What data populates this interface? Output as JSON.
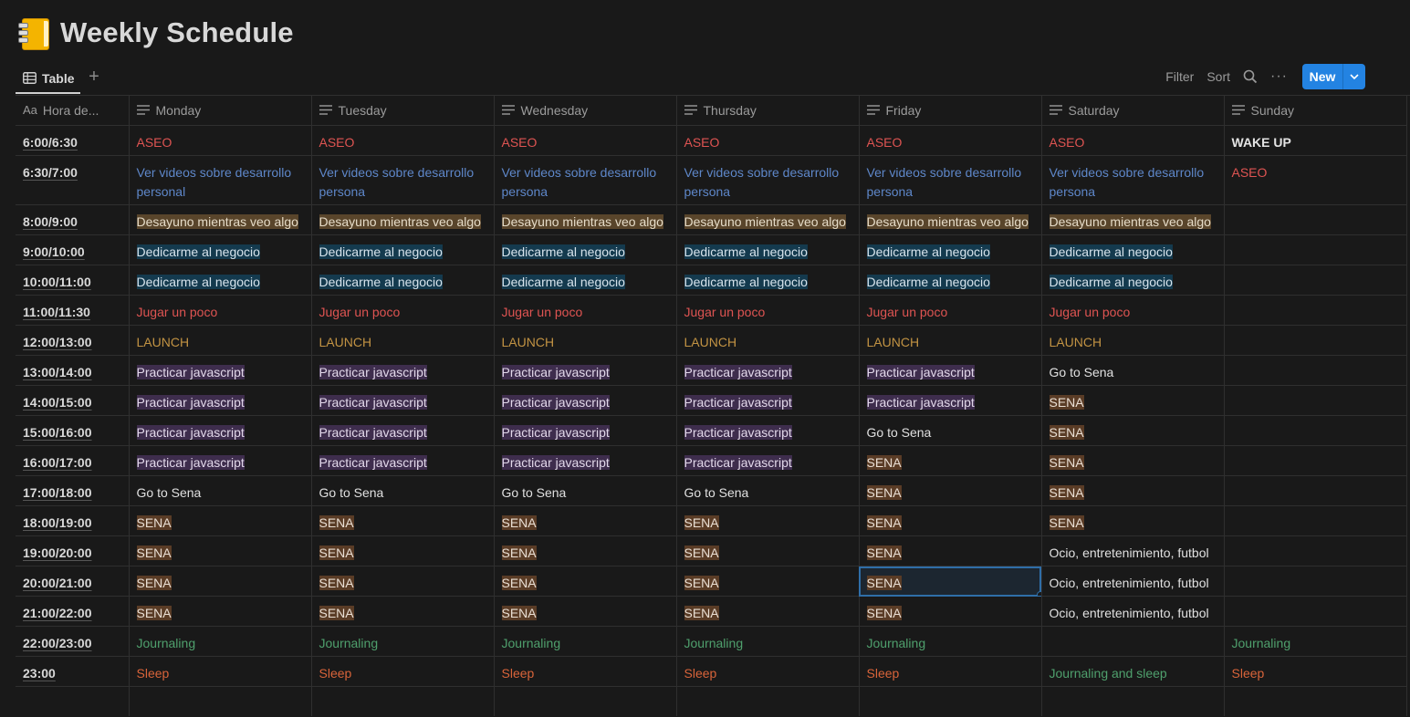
{
  "page": {
    "title": "Weekly Schedule",
    "icon": "notebook-emoji-icon"
  },
  "tabs": {
    "active": "Table",
    "add_icon": "plus-icon"
  },
  "toolbar": {
    "filter": "Filter",
    "sort": "Sort",
    "search_icon": "search-icon",
    "more_icon": "more-icon",
    "new_label": "New",
    "new_dropdown_icon": "chevron-down-icon"
  },
  "columns": [
    "Hora de...",
    "Monday",
    "Tuesday",
    "Wednesday",
    "Thursday",
    "Friday",
    "Saturday",
    "Sunday"
  ],
  "colors": {
    "accent": "#2383e2",
    "red": "#df5452",
    "blue": "#5e87c9",
    "gold": "#c29343",
    "coral": "#d9643a",
    "green": "#4fa06d"
  },
  "rows": [
    {
      "time": "6:00/6:30",
      "cells": [
        {
          "text": "ASEO",
          "style": "red"
        },
        {
          "text": "ASEO",
          "style": "red"
        },
        {
          "text": "ASEO",
          "style": "red"
        },
        {
          "text": "ASEO",
          "style": "red"
        },
        {
          "text": "ASEO",
          "style": "red"
        },
        {
          "text": "ASEO",
          "style": "red"
        },
        {
          "text": "WAKE UP",
          "style": "bold"
        }
      ]
    },
    {
      "time": "6:30/7:00",
      "cells": [
        {
          "text": "Ver videos sobre desarrollo personal",
          "style": "blue"
        },
        {
          "text": "Ver videos sobre desarrollo persona",
          "style": "blue"
        },
        {
          "text": "Ver videos sobre desarrollo persona",
          "style": "blue"
        },
        {
          "text": "Ver videos sobre desarrollo persona",
          "style": "blue"
        },
        {
          "text": "Ver videos sobre desarrollo persona",
          "style": "blue"
        },
        {
          "text": "Ver videos sobre desarrollo persona",
          "style": "blue"
        },
        {
          "text": "ASEO",
          "style": "red"
        }
      ]
    },
    {
      "time": "8:00/9:00",
      "cells": [
        {
          "text": "Desayuno mientras veo algo",
          "style": "orange-hl"
        },
        {
          "text": "Desayuno mientras veo algo",
          "style": "orange-hl"
        },
        {
          "text": "Desayuno mientras veo algo",
          "style": "orange-hl"
        },
        {
          "text": "Desayuno mientras veo algo",
          "style": "orange-hl"
        },
        {
          "text": "Desayuno mientras veo algo",
          "style": "orange-hl"
        },
        {
          "text": "Desayuno mientras veo algo",
          "style": "orange-hl"
        },
        {
          "text": "",
          "style": "plain"
        }
      ]
    },
    {
      "time": "9:00/10:00",
      "cells": [
        {
          "text": "Dedicarme al negocio",
          "style": "teal-hl"
        },
        {
          "text": "Dedicarme al negocio",
          "style": "teal-hl"
        },
        {
          "text": "Dedicarme al negocio",
          "style": "teal-hl"
        },
        {
          "text": "Dedicarme al negocio",
          "style": "teal-hl"
        },
        {
          "text": "Dedicarme al negocio",
          "style": "teal-hl"
        },
        {
          "text": "Dedicarme al negocio",
          "style": "teal-hl"
        },
        {
          "text": "",
          "style": "plain"
        }
      ]
    },
    {
      "time": "10:00/11:00",
      "cells": [
        {
          "text": "Dedicarme al negocio",
          "style": "teal-hl"
        },
        {
          "text": "Dedicarme al negocio",
          "style": "teal-hl"
        },
        {
          "text": "Dedicarme al negocio",
          "style": "teal-hl"
        },
        {
          "text": "Dedicarme al negocio",
          "style": "teal-hl"
        },
        {
          "text": "Dedicarme al negocio",
          "style": "teal-hl"
        },
        {
          "text": "Dedicarme al negocio",
          "style": "teal-hl"
        },
        {
          "text": "",
          "style": "plain"
        }
      ]
    },
    {
      "time": "11:00/11:30",
      "cells": [
        {
          "text": "Jugar un poco",
          "style": "red"
        },
        {
          "text": "Jugar un poco",
          "style": "red"
        },
        {
          "text": "Jugar un poco",
          "style": "red"
        },
        {
          "text": "Jugar un poco",
          "style": "red"
        },
        {
          "text": "Jugar un poco",
          "style": "red"
        },
        {
          "text": "Jugar un poco",
          "style": "red"
        },
        {
          "text": "",
          "style": "plain"
        }
      ]
    },
    {
      "time": "12:00/13:00",
      "cells": [
        {
          "text": "LAUNCH",
          "style": "gold"
        },
        {
          "text": "LAUNCH",
          "style": "gold"
        },
        {
          "text": "LAUNCH",
          "style": "gold"
        },
        {
          "text": "LAUNCH",
          "style": "gold"
        },
        {
          "text": "LAUNCH",
          "style": "gold"
        },
        {
          "text": "LAUNCH",
          "style": "gold"
        },
        {
          "text": "",
          "style": "plain"
        }
      ]
    },
    {
      "time": "13:00/14:00",
      "cells": [
        {
          "text": "Practicar javascript",
          "style": "purple-hl"
        },
        {
          "text": "Practicar javascript",
          "style": "purple-hl"
        },
        {
          "text": "Practicar javascript",
          "style": "purple-hl"
        },
        {
          "text": "Practicar javascript",
          "style": "purple-hl"
        },
        {
          "text": "Practicar javascript",
          "style": "purple-hl"
        },
        {
          "text": "Go to Sena",
          "style": "plain"
        },
        {
          "text": "",
          "style": "plain"
        }
      ]
    },
    {
      "time": "14:00/15:00",
      "cells": [
        {
          "text": "Practicar javascript",
          "style": "purple-hl"
        },
        {
          "text": "Practicar javascript",
          "style": "purple-hl"
        },
        {
          "text": "Practicar javascript",
          "style": "purple-hl"
        },
        {
          "text": "Practicar javascript",
          "style": "purple-hl"
        },
        {
          "text": "Practicar javascript",
          "style": "purple-hl"
        },
        {
          "text": "SENA",
          "style": "brown-hl"
        },
        {
          "text": "",
          "style": "plain"
        }
      ]
    },
    {
      "time": "15:00/16:00",
      "cells": [
        {
          "text": "Practicar javascript",
          "style": "purple-hl"
        },
        {
          "text": "Practicar javascript",
          "style": "purple-hl"
        },
        {
          "text": "Practicar javascript",
          "style": "purple-hl"
        },
        {
          "text": "Practicar javascript",
          "style": "purple-hl"
        },
        {
          "text": "Go to Sena",
          "style": "plain"
        },
        {
          "text": "SENA",
          "style": "brown-hl"
        },
        {
          "text": "",
          "style": "plain"
        }
      ]
    },
    {
      "time": "16:00/17:00",
      "cells": [
        {
          "text": "Practicar javascript",
          "style": "purple-hl"
        },
        {
          "text": "Practicar javascript",
          "style": "purple-hl"
        },
        {
          "text": "Practicar javascript",
          "style": "purple-hl"
        },
        {
          "text": "Practicar javascript",
          "style": "purple-hl"
        },
        {
          "text": "SENA",
          "style": "brown-hl"
        },
        {
          "text": "SENA",
          "style": "brown-hl"
        },
        {
          "text": "",
          "style": "plain"
        }
      ]
    },
    {
      "time": "17:00/18:00",
      "cells": [
        {
          "text": "Go to Sena",
          "style": "plain"
        },
        {
          "text": "Go to Sena",
          "style": "plain"
        },
        {
          "text": "Go to Sena",
          "style": "plain"
        },
        {
          "text": "Go to Sena",
          "style": "plain"
        },
        {
          "text": "SENA",
          "style": "brown-hl"
        },
        {
          "text": "SENA",
          "style": "brown-hl"
        },
        {
          "text": "",
          "style": "plain"
        }
      ]
    },
    {
      "time": "18:00/19:00",
      "cells": [
        {
          "text": "SENA",
          "style": "brown-hl"
        },
        {
          "text": "SENA",
          "style": "brown-hl"
        },
        {
          "text": "SENA",
          "style": "brown-hl"
        },
        {
          "text": "SENA",
          "style": "brown-hl"
        },
        {
          "text": "SENA",
          "style": "brown-hl"
        },
        {
          "text": "SENA",
          "style": "brown-hl"
        },
        {
          "text": "",
          "style": "plain"
        }
      ]
    },
    {
      "time": "19:00/20:00",
      "cells": [
        {
          "text": "SENA",
          "style": "brown-hl"
        },
        {
          "text": "SENA",
          "style": "brown-hl"
        },
        {
          "text": "SENA",
          "style": "brown-hl"
        },
        {
          "text": "SENA",
          "style": "brown-hl"
        },
        {
          "text": "SENA",
          "style": "brown-hl"
        },
        {
          "text": "Ocio, entretenimiento, futbol",
          "style": "plain"
        },
        {
          "text": "",
          "style": "plain"
        }
      ]
    },
    {
      "time": "20:00/21:00",
      "cells": [
        {
          "text": "SENA",
          "style": "brown-hl"
        },
        {
          "text": "SENA",
          "style": "brown-hl"
        },
        {
          "text": "SENA",
          "style": "brown-hl"
        },
        {
          "text": "SENA",
          "style": "brown-hl"
        },
        {
          "text": "SENA",
          "style": "brown-hl",
          "selected": true
        },
        {
          "text": "Ocio, entretenimiento, futbol",
          "style": "plain"
        },
        {
          "text": "",
          "style": "plain"
        }
      ]
    },
    {
      "time": "21:00/22:00",
      "cells": [
        {
          "text": "SENA",
          "style": "brown-hl"
        },
        {
          "text": "SENA",
          "style": "brown-hl"
        },
        {
          "text": "SENA",
          "style": "brown-hl"
        },
        {
          "text": "SENA",
          "style": "brown-hl"
        },
        {
          "text": "SENA",
          "style": "brown-hl"
        },
        {
          "text": "Ocio, entretenimiento, futbol",
          "style": "plain"
        },
        {
          "text": "",
          "style": "plain"
        }
      ]
    },
    {
      "time": "22:00/23:00",
      "cells": [
        {
          "text": "Journaling",
          "style": "green"
        },
        {
          "text": "Journaling",
          "style": "green"
        },
        {
          "text": "Journaling",
          "style": "green"
        },
        {
          "text": "Journaling",
          "style": "green"
        },
        {
          "text": "Journaling",
          "style": "green"
        },
        {
          "text": "",
          "style": "plain"
        },
        {
          "text": "Journaling",
          "style": "green"
        }
      ]
    },
    {
      "time": "23:00",
      "cells": [
        {
          "text": "Sleep",
          "style": "coral"
        },
        {
          "text": "Sleep",
          "style": "coral"
        },
        {
          "text": "Sleep",
          "style": "coral"
        },
        {
          "text": "Sleep",
          "style": "coral"
        },
        {
          "text": "Sleep",
          "style": "coral"
        },
        {
          "text": "Journaling and sleep",
          "style": "green"
        },
        {
          "text": "Sleep",
          "style": "coral"
        }
      ]
    }
  ]
}
